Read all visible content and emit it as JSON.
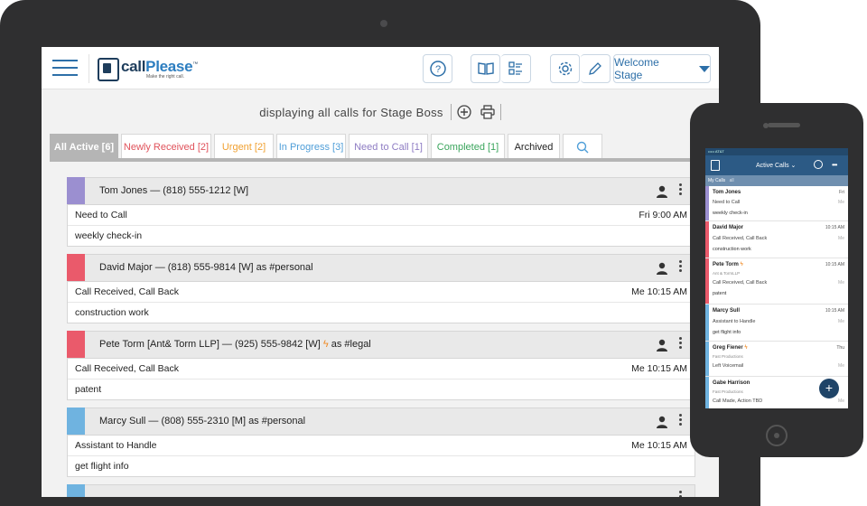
{
  "app": {
    "logo_main": "call",
    "logo_accent": "Please",
    "logo_tm": "™",
    "tagline": "Make the right call.",
    "help_icon": "question-circle-icon",
    "book_icon": "book-icon",
    "list_icon": "checklist-icon",
    "settings_icon": "gear-icon",
    "edit_icon": "pencil-icon",
    "welcome_label": "Welcome Stage",
    "accent_color": "#2d6fa8"
  },
  "header": {
    "displaying_text": "displaying all calls for Stage Boss",
    "add_icon": "plus-circle-icon",
    "print_icon": "printer-icon"
  },
  "tabs": [
    {
      "label": "All Active [6]",
      "color": "#ffffff",
      "active": true
    },
    {
      "label": "Newly Received [2]",
      "color": "#e0525b",
      "active": false
    },
    {
      "label": "Urgent [2]",
      "color": "#f0a030",
      "active": false
    },
    {
      "label": "In Progress [3]",
      "color": "#4f9ed8",
      "active": false
    },
    {
      "label": "Need to Call [1]",
      "color": "#8e7cc3",
      "active": false
    },
    {
      "label": "Completed [1]",
      "color": "#3aa55c",
      "active": false
    },
    {
      "label": "Archived",
      "color": "#222222",
      "active": false
    }
  ],
  "search_icon": "search-icon",
  "calls": [
    {
      "contact": "Tom Jones — (818) 555-1212 [W]",
      "status": "Need to Call",
      "time": "Fri 9:00 AM",
      "note": "weekly check-in",
      "color": "#9b8fd0"
    },
    {
      "contact": "David Major — (818) 555-9814 [W] as #personal",
      "status": "Call Received, Call Back",
      "time": "Me 10:15 AM",
      "note": "construction work",
      "color": "#ea5a6b"
    },
    {
      "contact": "Pete Torm [Ant& Torm LLP] — (925) 555-9842 [W]",
      "urgent_mark": "ϟ",
      "tag": "as #legal",
      "status": "Call Received, Call Back",
      "time": "Me 10:15 AM",
      "note": "patent",
      "color": "#ea5a6b"
    },
    {
      "contact": "Marcy Sull — (808) 555-2310 [M] as #personal",
      "status": "Assistant to Handle",
      "time": "Me 10:15 AM",
      "note": "get flight info",
      "color": "#6fb3e0"
    }
  ],
  "phone": {
    "status_text": "••••• AT&T",
    "title": "Active Calls",
    "sub_title": "My Calls",
    "sub_all": "all",
    "items": [
      {
        "name": "Tom Jones",
        "time": "Fri",
        "status": "Need to Call",
        "me": "Me",
        "note": "weekly check-in",
        "color": "#9b8fd0"
      },
      {
        "name": "David Major",
        "time": "10:15 AM",
        "status": "Call Received, Call Back",
        "me": "Me",
        "note": "construction work",
        "color": "#ea5a6b"
      },
      {
        "name": "Pete Torm",
        "time": "10:15 AM",
        "company": "Ant & TormLLP",
        "status": "Call Received, Call Back",
        "me": "Me",
        "note": "patent",
        "color": "#ea5a6b"
      },
      {
        "name": "Marcy Sull",
        "time": "10:15 AM",
        "status": "Assistant to Handle",
        "me": "Me",
        "note": "get flight info",
        "color": "#6fb3e0"
      },
      {
        "name": "Greg Fiener",
        "time": "Thu",
        "company": "Fast Productions",
        "status": "Left Voicemail",
        "me": "Me",
        "color": "#6fb3e0"
      },
      {
        "name": "Gabe Harrison",
        "time": "",
        "company": "Fast Productions",
        "status": "Call Made, Action TBD",
        "me": "Me",
        "color": "#6fb3e0"
      }
    ],
    "fab_label": "+"
  }
}
